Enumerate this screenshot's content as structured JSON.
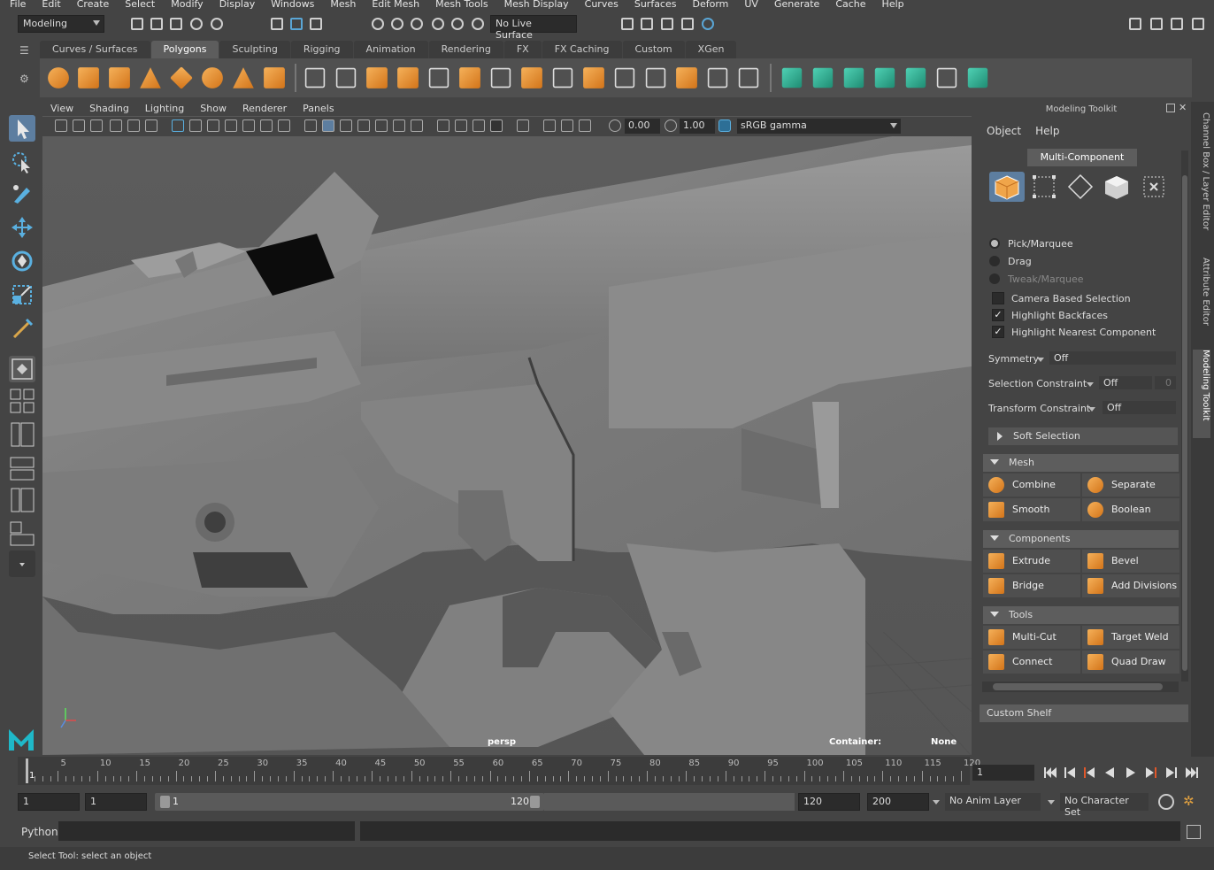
{
  "menubar": [
    "File",
    "Edit",
    "Create",
    "Select",
    "Modify",
    "Display",
    "Windows",
    "Mesh",
    "Edit Mesh",
    "Mesh Tools",
    "Mesh Display",
    "Curves",
    "Surfaces",
    "Deform",
    "UV",
    "Generate",
    "Cache",
    "Help"
  ],
  "status": {
    "mode": "Modeling",
    "live_surface": "No Live Surface"
  },
  "shelf_tabs": [
    "Curves / Surfaces",
    "Polygons",
    "Sculpting",
    "Rigging",
    "Animation",
    "Rendering",
    "FX",
    "FX Caching",
    "Custom",
    "XGen"
  ],
  "active_shelf_tab": "Polygons",
  "viewport": {
    "menu": [
      "View",
      "Shading",
      "Lighting",
      "Show",
      "Renderer",
      "Panels"
    ],
    "exposure": "0.00",
    "gamma_value": "1.00",
    "color_space": "sRGB gamma",
    "camera_label": "persp",
    "container_label": "Container:",
    "container_value": "None"
  },
  "toolkit": {
    "title": "Modeling Toolkit",
    "menu": [
      "Object",
      "Help"
    ],
    "multi_component": "Multi-Component",
    "selection_modes": [
      {
        "label": "Pick/Marquee",
        "selected": true,
        "dim": false
      },
      {
        "label": "Drag",
        "selected": false,
        "dim": false
      },
      {
        "label": "Tweak/Marquee",
        "selected": false,
        "dim": true
      }
    ],
    "checkboxes": [
      {
        "label": "Camera Based Selection",
        "checked": false
      },
      {
        "label": "Highlight Backfaces",
        "checked": true
      },
      {
        "label": "Highlight Nearest Component",
        "checked": true
      }
    ],
    "symmetry": {
      "label": "Symmetry",
      "value": "Off"
    },
    "selection_constraint": {
      "label": "Selection Constraint",
      "value": "Off",
      "num": "0"
    },
    "transform_constraint": {
      "label": "Transform Constraint",
      "value": "Off"
    },
    "soft_selection": "Soft Selection",
    "sections": [
      {
        "title": "Mesh",
        "buttons": [
          "Combine",
          "Separate",
          "Smooth",
          "Boolean"
        ]
      },
      {
        "title": "Components",
        "buttons": [
          "Extrude",
          "Bevel",
          "Bridge",
          "Add Divisions"
        ]
      },
      {
        "title": "Tools",
        "buttons": [
          "Multi-Cut",
          "Target Weld",
          "Connect",
          "Quad Draw"
        ]
      }
    ],
    "custom_shelf": "Custom Shelf"
  },
  "side_tabs": [
    "Channel Box / Layer Editor",
    "Attribute Editor",
    "Modeling Toolkit"
  ],
  "timeline": {
    "ticks": [
      1,
      5,
      10,
      15,
      20,
      25,
      30,
      35,
      40,
      45,
      50,
      55,
      60,
      65,
      70,
      75,
      80,
      85,
      90,
      95,
      100,
      105,
      110,
      115,
      120
    ],
    "current_frame": "1"
  },
  "range": {
    "start": "1",
    "playback_start": "1",
    "slider_start": "1",
    "slider_end": "120",
    "playback_end": "120",
    "end": "200",
    "anim_layer": "No Anim Layer",
    "character_set": "No Character Set"
  },
  "command": {
    "language": "Python"
  },
  "help_line": "Select Tool: select an object"
}
